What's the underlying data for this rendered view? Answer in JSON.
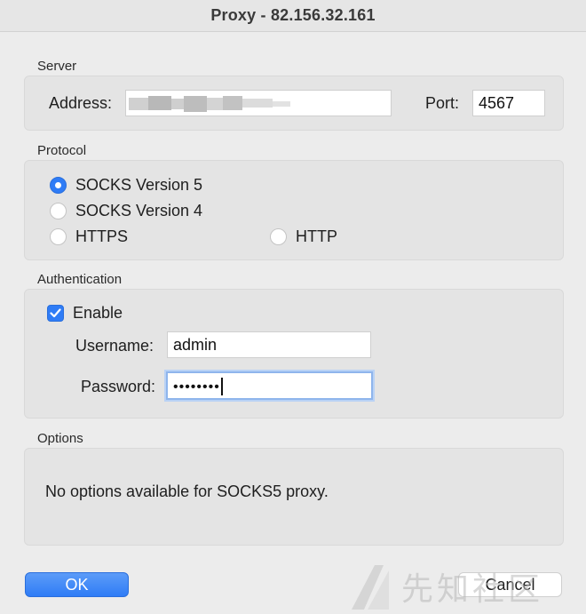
{
  "window": {
    "title": "Proxy - 82.156.32.161"
  },
  "server": {
    "section_label": "Server",
    "address_label": "Address:",
    "port_label": "Port:",
    "port_value": "4567"
  },
  "protocol": {
    "section_label": "Protocol",
    "options": [
      {
        "label": "SOCKS Version 5",
        "selected": true
      },
      {
        "label": "SOCKS Version 4",
        "selected": false
      },
      {
        "label": "HTTPS",
        "selected": false
      },
      {
        "label": "HTTP",
        "selected": false
      }
    ]
  },
  "authentication": {
    "section_label": "Authentication",
    "enable_label": "Enable",
    "enabled": true,
    "username_label": "Username:",
    "username_value": "admin",
    "password_label": "Password:",
    "password_mask": "••••••••"
  },
  "options": {
    "section_label": "Options",
    "message": "No options available for SOCKS5 proxy."
  },
  "buttons": {
    "ok_label": "OK",
    "cancel_label": "Cancel"
  },
  "watermark": {
    "text": "先知社区"
  },
  "colors": {
    "accent": "#2f7cf6",
    "background": "#ececec",
    "group_background": "#e4e4e4"
  }
}
